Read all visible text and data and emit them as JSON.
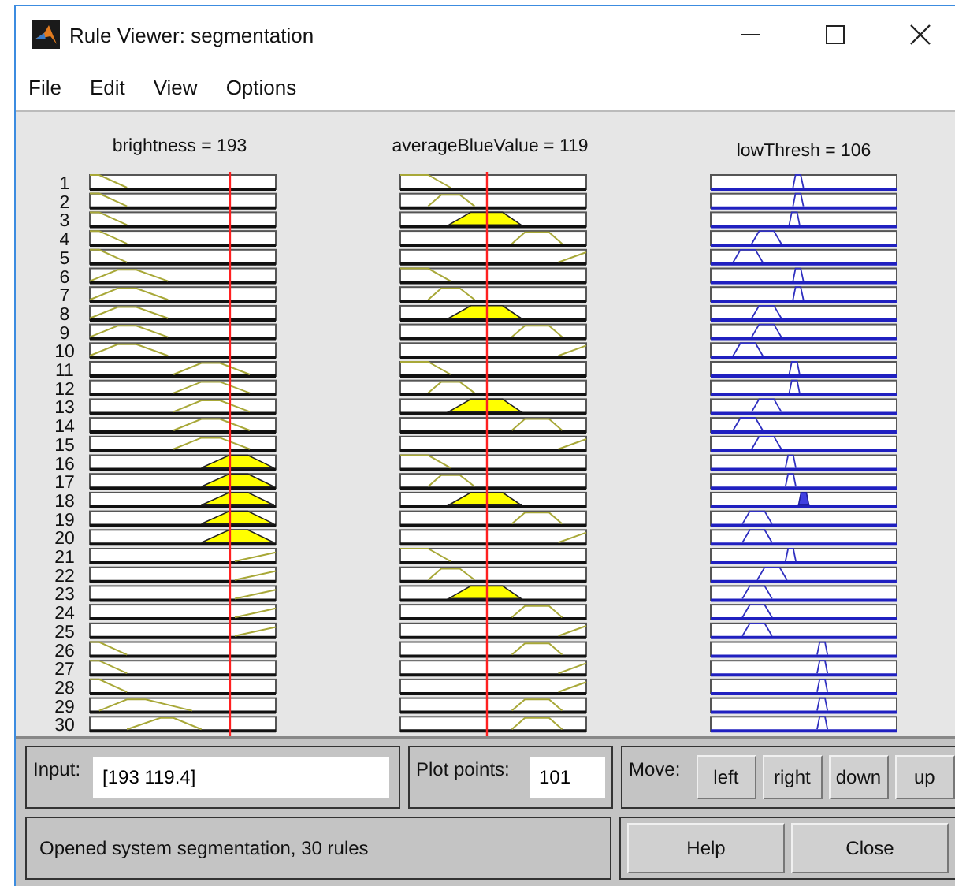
{
  "window": {
    "title": "Rule Viewer: segmentation"
  },
  "menu": [
    "File",
    "Edit",
    "View",
    "Options"
  ],
  "columns": [
    {
      "kind": "input",
      "heading": "brightness = 193"
    },
    {
      "kind": "input",
      "heading": "averageBlueValue = 119"
    },
    {
      "kind": "output",
      "heading": "lowThresh = 106"
    }
  ],
  "rules": [
    {
      "number": "1",
      "fired": [
        false,
        false,
        false
      ]
    },
    {
      "number": "2",
      "fired": [
        false,
        false,
        false
      ]
    },
    {
      "number": "3",
      "fired": [
        false,
        true,
        false
      ]
    },
    {
      "number": "4",
      "fired": [
        false,
        false,
        false
      ]
    },
    {
      "number": "5",
      "fired": [
        false,
        false,
        false
      ]
    },
    {
      "number": "6",
      "fired": [
        false,
        false,
        false
      ]
    },
    {
      "number": "7",
      "fired": [
        false,
        false,
        false
      ]
    },
    {
      "number": "8",
      "fired": [
        false,
        true,
        false
      ]
    },
    {
      "number": "9",
      "fired": [
        false,
        false,
        false
      ]
    },
    {
      "number": "10",
      "fired": [
        false,
        false,
        false
      ]
    },
    {
      "number": "11",
      "fired": [
        false,
        false,
        false
      ]
    },
    {
      "number": "12",
      "fired": [
        false,
        false,
        false
      ]
    },
    {
      "number": "13",
      "fired": [
        false,
        true,
        false
      ]
    },
    {
      "number": "14",
      "fired": [
        false,
        false,
        false
      ]
    },
    {
      "number": "15",
      "fired": [
        false,
        false,
        false
      ]
    },
    {
      "number": "16",
      "fired": [
        true,
        false,
        false
      ]
    },
    {
      "number": "17",
      "fired": [
        true,
        false,
        false
      ]
    },
    {
      "number": "18",
      "fired": [
        true,
        true,
        true
      ]
    },
    {
      "number": "19",
      "fired": [
        true,
        false,
        false
      ]
    },
    {
      "number": "20",
      "fired": [
        true,
        false,
        false
      ]
    },
    {
      "number": "21",
      "fired": [
        false,
        false,
        false
      ]
    },
    {
      "number": "22",
      "fired": [
        false,
        false,
        false
      ]
    },
    {
      "number": "23",
      "fired": [
        false,
        true,
        false
      ]
    },
    {
      "number": "24",
      "fired": [
        false,
        false,
        false
      ]
    },
    {
      "number": "25",
      "fired": [
        false,
        false,
        false
      ]
    },
    {
      "number": "26",
      "fired": [
        false,
        false,
        false
      ]
    },
    {
      "number": "27",
      "fired": [
        false,
        false,
        false
      ]
    },
    {
      "number": "28",
      "fired": [
        false,
        false,
        false
      ]
    },
    {
      "number": "29",
      "fired": [
        false,
        false,
        false
      ]
    },
    {
      "number": "30",
      "fired": [
        false,
        false,
        false
      ]
    }
  ],
  "input": {
    "label": "Input:",
    "value": "[193 119.4]"
  },
  "plot_points": {
    "label": "Plot points:",
    "value": "101"
  },
  "move": {
    "label": "Move:",
    "buttons": [
      "left",
      "right",
      "down",
      "up"
    ]
  },
  "status": "Opened system segmentation, 30 rules",
  "buttons": [
    "Help",
    "Close"
  ]
}
